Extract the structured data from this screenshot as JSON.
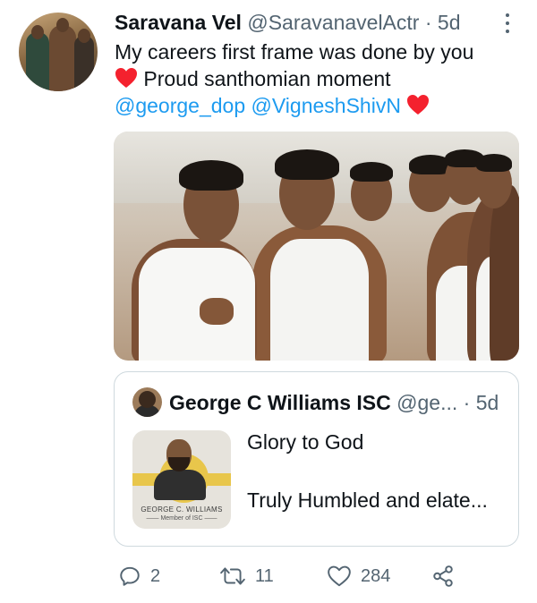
{
  "tweet": {
    "author_name": "Saravana Vel",
    "handle": "@SaravanavelActr",
    "separator": "·",
    "time": "5d",
    "text_line1": "My careers first frame was done by you",
    "text_line2_after_heart": "Proud santhomian moment",
    "mention1": "@george_dop",
    "mention2": "@VigneshShivN"
  },
  "quoted_tweet": {
    "author_name": "George C Williams ISC",
    "handle": "@ge...",
    "separator": "·",
    "time": "5d",
    "thumb_caption1": "GEORGE C. WILLIAMS",
    "thumb_caption2": "—— Member of ISC ——",
    "text_line1": "Glory to God",
    "text_line2": "Truly Humbled and elate..."
  },
  "actions": {
    "replies": "2",
    "retweets": "11",
    "likes": "284"
  },
  "colors": {
    "link": "#1d9bf0",
    "heart": "#f4212e",
    "muted": "#536471",
    "border": "#cfd9de"
  },
  "icons": [
    "more-icon",
    "heart-emoji-icon",
    "reply-icon",
    "retweet-icon",
    "like-icon",
    "share-icon"
  ]
}
